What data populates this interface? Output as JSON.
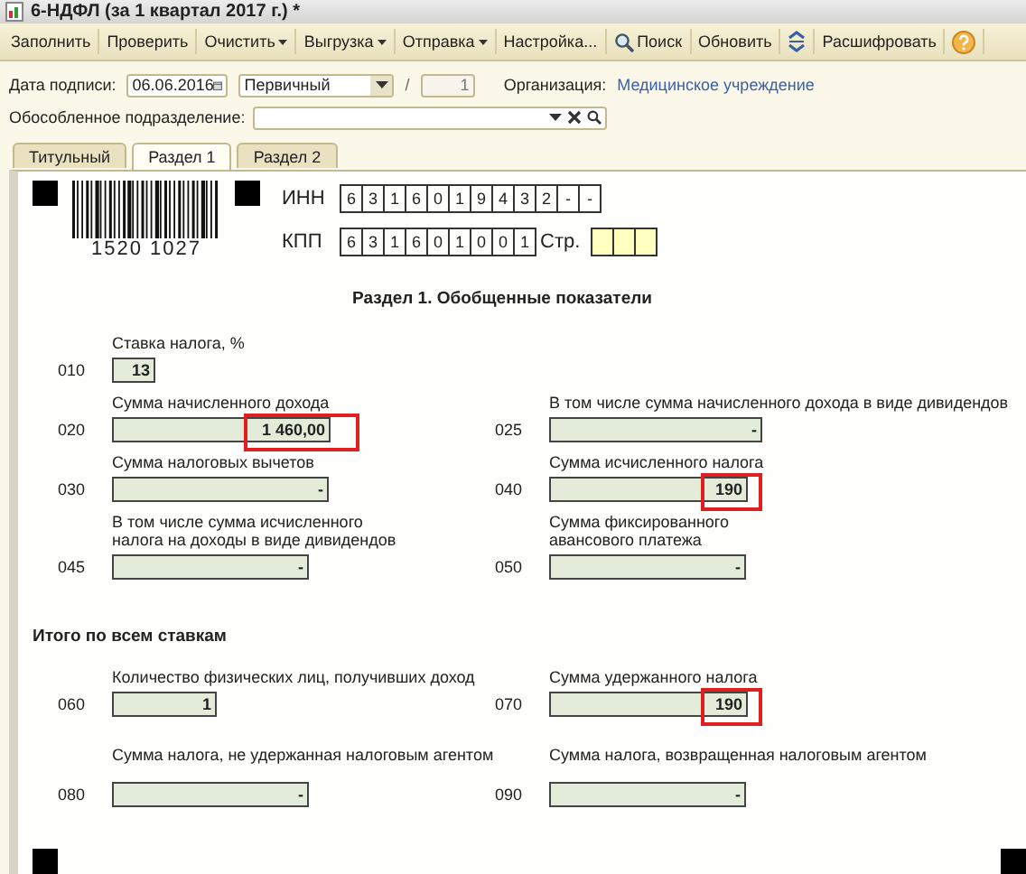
{
  "window": {
    "title": "6-НДФЛ (за 1 квартал 2017 г.) *"
  },
  "toolbar": [
    {
      "kind": "text",
      "label": "Заполнить"
    },
    {
      "kind": "text",
      "label": "Проверить"
    },
    {
      "kind": "menu",
      "label": "Очистить"
    },
    {
      "kind": "menu",
      "label": "Выгрузка"
    },
    {
      "kind": "menu",
      "label": "Отправка"
    },
    {
      "kind": "text",
      "label": "Настройка..."
    },
    {
      "kind": "search",
      "label": "Поиск"
    },
    {
      "kind": "text",
      "label": "Обновить"
    },
    {
      "kind": "expand"
    },
    {
      "kind": "text",
      "label": "Расшифровать"
    },
    {
      "kind": "help"
    }
  ],
  "header": {
    "date_label": "Дата подписи:",
    "date": "06.06.2016",
    "type": "Первичный",
    "separator": "/",
    "correction": "1",
    "org_label": "Организация:",
    "org": "Медицинское учреждение",
    "division_label": "Обособленное подразделение:"
  },
  "tabs": [
    {
      "label": "Титульный",
      "selected": false
    },
    {
      "label": "Раздел 1",
      "selected": true
    },
    {
      "label": "Раздел 2",
      "selected": false
    }
  ],
  "form": {
    "barcode": "1520 1027",
    "inn_label": "ИНН",
    "inn": [
      "6",
      "3",
      "1",
      "6",
      "0",
      "1",
      "9",
      "4",
      "3",
      "2",
      "-",
      "-"
    ],
    "kpp_label": "КПП",
    "kpp": [
      "6",
      "3",
      "1",
      "6",
      "0",
      "1",
      "0",
      "0",
      "1"
    ],
    "page_label": "Стр.",
    "heading": "Раздел 1. Обобщенные показатели",
    "rate": {
      "code": "010",
      "label": "Ставка налога, %",
      "value": "13"
    },
    "fields": [
      {
        "code": "020",
        "label": "Сумма начисленного дохода",
        "value": "1 460,00",
        "highlighted": true
      },
      {
        "code": "025",
        "label": "В том числе сумма начисленного дохода в виде дивидендов",
        "value": "-",
        "highlighted": false
      },
      {
        "code": "030",
        "label": "Сумма налоговых вычетов",
        "value": "-",
        "highlighted": false
      },
      {
        "code": "040",
        "label": "Сумма исчисленного налога",
        "value": "190",
        "highlighted": true
      },
      {
        "code": "045",
        "label": "В том числе сумма исчисленного налога на доходы в виде дивидендов",
        "value": "-",
        "highlighted": false
      },
      {
        "code": "050",
        "label": "Сумма фиксированного авансового платежа",
        "value": "-",
        "highlighted": false
      }
    ],
    "totals_heading": "Итого по всем ставкам",
    "totals": [
      {
        "code": "060",
        "label": "Количество физических лиц, получивших доход",
        "value": "1",
        "highlighted": false
      },
      {
        "code": "070",
        "label": "Сумма удержанного налога",
        "value": "190",
        "highlighted": true
      },
      {
        "code": "080",
        "label": "Сумма налога, не удержанная налоговым агентом",
        "value": "-",
        "highlighted": false
      },
      {
        "code": "090",
        "label": "Сумма налога, возвращенная налоговым агентом",
        "value": "-",
        "highlighted": false
      }
    ]
  }
}
